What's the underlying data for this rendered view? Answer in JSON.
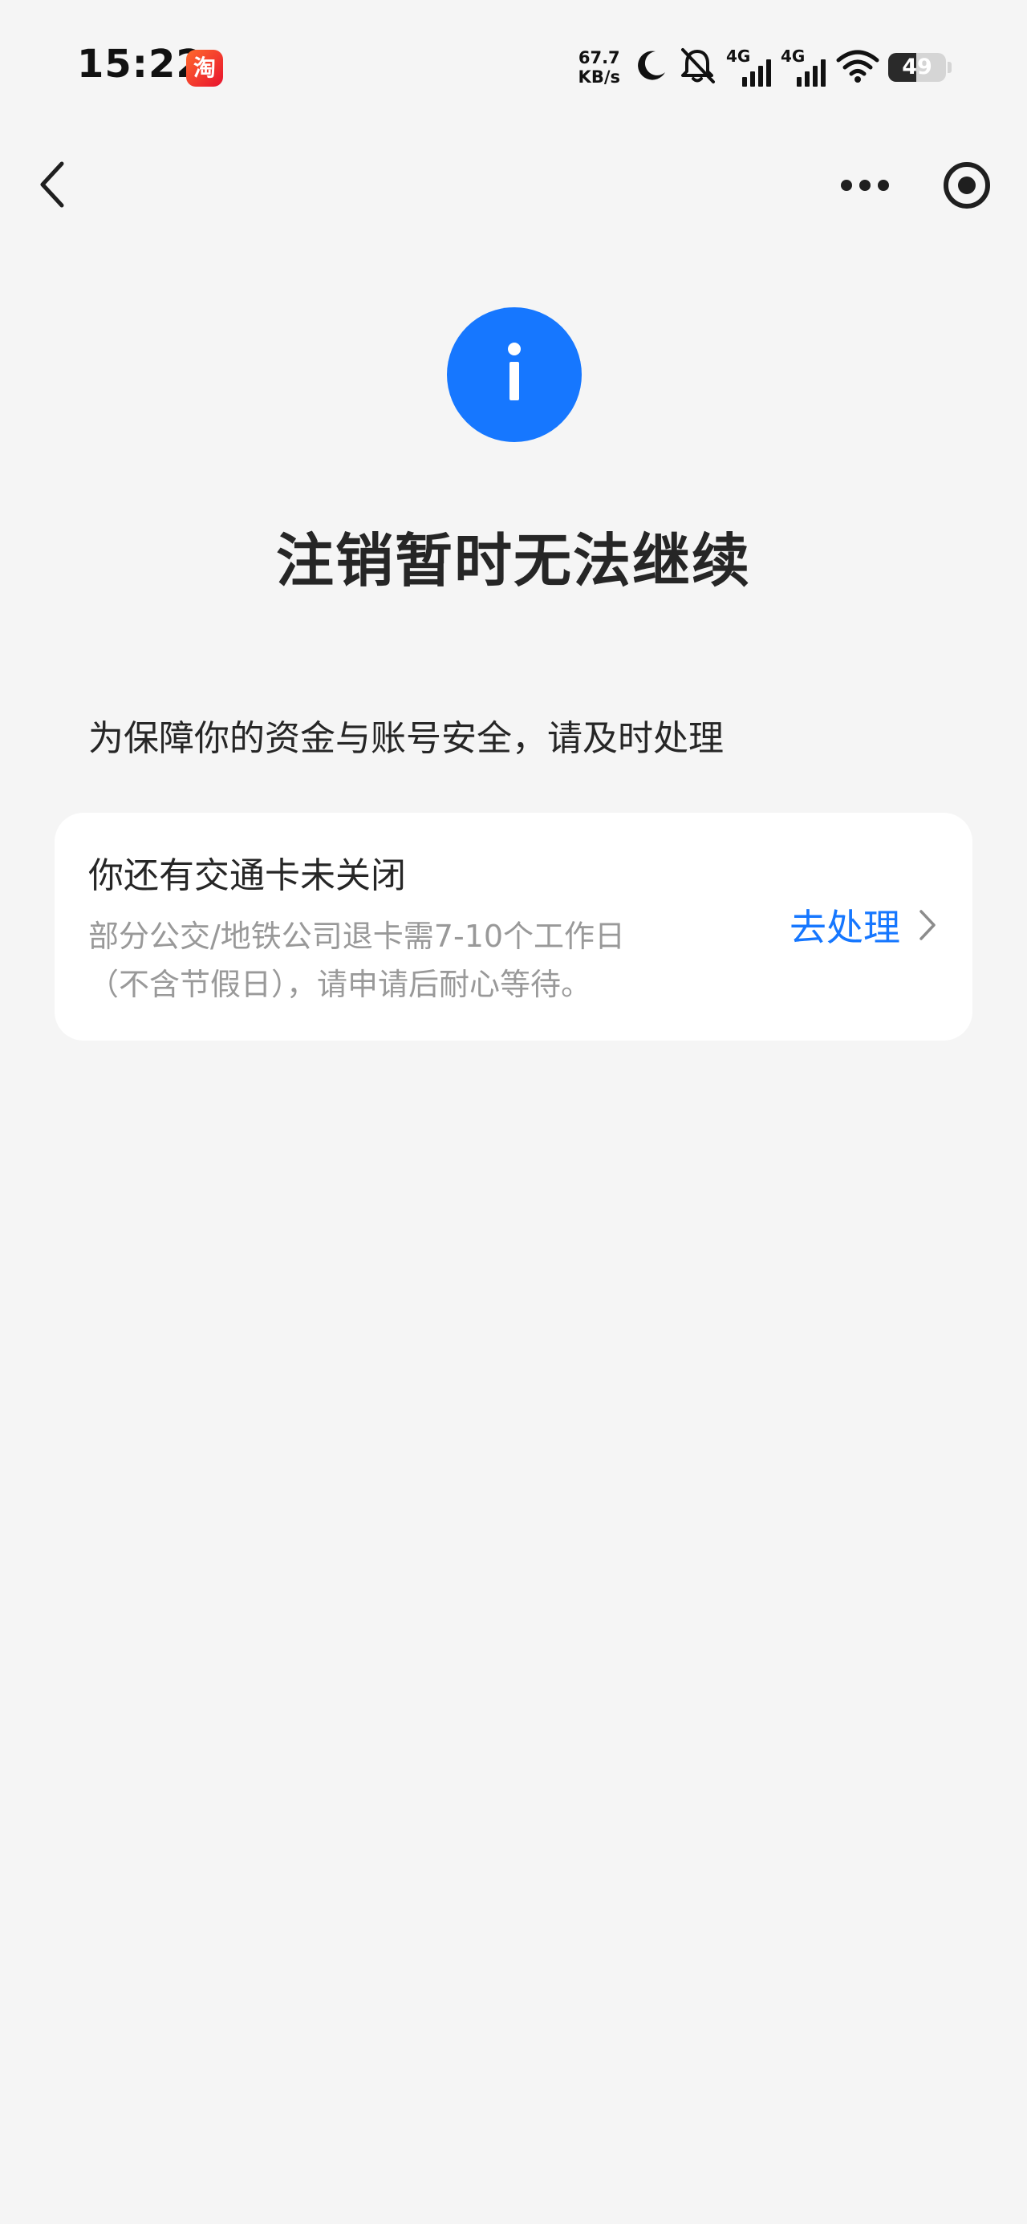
{
  "status_bar": {
    "time": "15:22",
    "taobao_icon_glyph": "淘",
    "net_speed_value": "67.7",
    "net_speed_unit": "KB/s",
    "signal_1_tag": "4G",
    "signal_2_tag": "4G",
    "battery_level": "49",
    "icons": [
      "taobao-app-icon",
      "moon-icon",
      "muted-bell-icon",
      "signal-icon",
      "signal-icon",
      "wifi-icon",
      "battery-icon"
    ]
  },
  "nav": {
    "back_icon": "chevron-left-icon",
    "more_icon": "more-dots-icon",
    "close_icon": "target-close-icon"
  },
  "result": {
    "icon": "info-icon",
    "icon_color": "#1677ff",
    "title": "注销暂时无法继续",
    "subtitle": "为保障你的资金与账号安全，请及时处理"
  },
  "task": {
    "title": "你还有交通卡未关闭",
    "desc_line1": "部分公交/地铁公司退卡需7-10个工作日",
    "desc_line2": "（不含节假日），请申请后耐心等待。",
    "action_label": "去处理",
    "action_color": "#1677ff",
    "chevron_icon": "chevron-right-icon"
  }
}
